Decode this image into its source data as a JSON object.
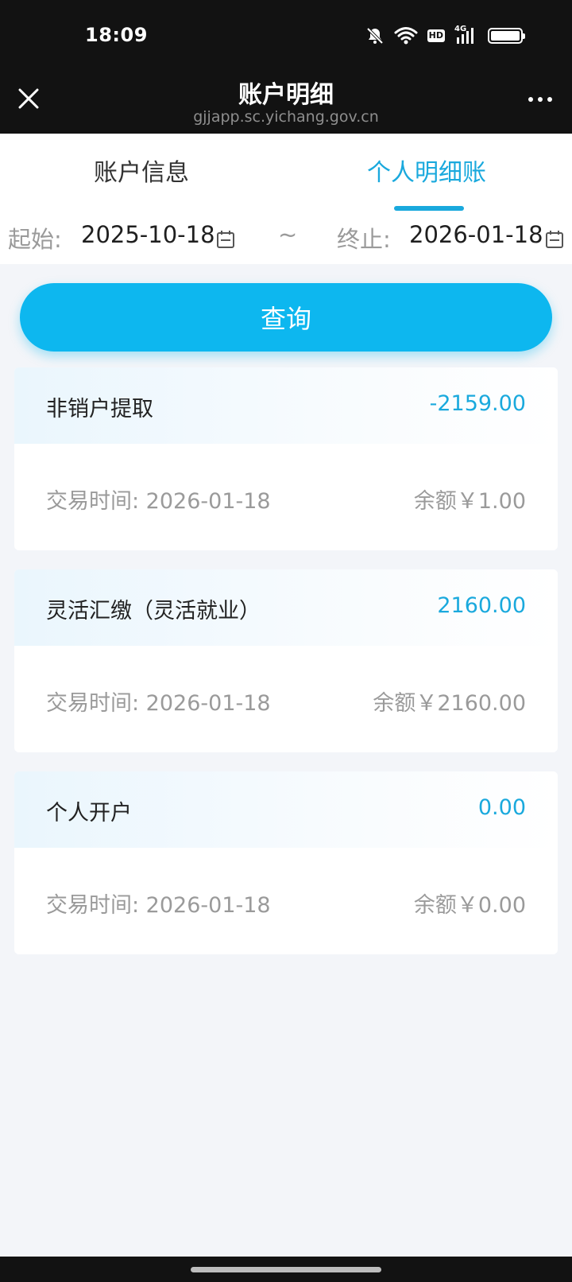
{
  "status_bar": {
    "time": "18:09",
    "network_label": "4G",
    "hd_label": "HD",
    "icons": [
      "bell-off-icon",
      "wifi-icon",
      "hd-icon",
      "signal-icon",
      "battery-icon"
    ]
  },
  "header": {
    "title": "账户明细",
    "url": "gjjapp.sc.yichang.gov.cn",
    "close_icon": "close-icon",
    "more_icon": "more-icon"
  },
  "tabs": [
    {
      "label": "账户信息",
      "active": false
    },
    {
      "label": "个人明细账",
      "active": true
    }
  ],
  "date_filter": {
    "start_label": "起始:",
    "start_value": "2025-10-18",
    "separator": "~",
    "end_label": "终止:",
    "end_value": "2026-01-18"
  },
  "query_button": {
    "label": "查询"
  },
  "transactions": [
    {
      "type": "非销户提取",
      "amount": "-2159.00",
      "time": "交易时间: 2026-01-18",
      "balance": "余额￥1.00"
    },
    {
      "type": "灵活汇缴（灵活就业）",
      "amount": "2160.00",
      "time": "交易时间: 2026-01-18",
      "balance": "余额￥2160.00"
    },
    {
      "type": "个人开户",
      "amount": "0.00",
      "time": "交易时间: 2026-01-18",
      "balance": "余额￥0.00"
    }
  ],
  "colors": {
    "accent": "#1aa9dd",
    "button": "#0db7ef",
    "header_bg": "#121212",
    "page_bg": "#f3f5f9"
  }
}
